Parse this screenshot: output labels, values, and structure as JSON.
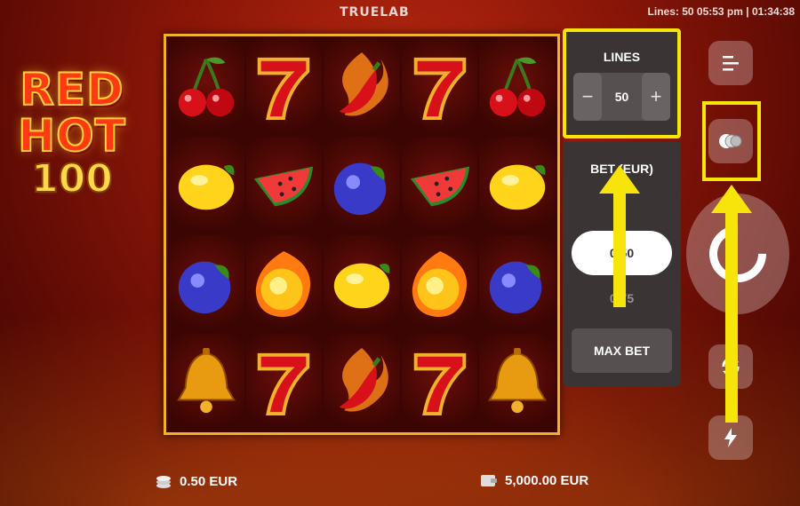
{
  "header": {
    "brand": "TRUELAB",
    "status": "Lines: 50  05:53 pm | 01:34:38"
  },
  "logo": {
    "line1": "RED",
    "line2": "HOT",
    "line3": "100"
  },
  "reels": {
    "rows": [
      [
        "cherry",
        "seven",
        "chili",
        "seven",
        "cherry"
      ],
      [
        "lemon",
        "watermelon",
        "plum",
        "watermelon",
        "lemon"
      ],
      [
        "plum",
        "fireball",
        "lemon",
        "fireball",
        "plum"
      ],
      [
        "bell",
        "seven",
        "chili",
        "seven",
        "bell"
      ]
    ]
  },
  "lines_panel": {
    "title": "LINES",
    "minus": "−",
    "value": "50",
    "plus": "+"
  },
  "bet_panel": {
    "title": "BET (EUR)",
    "selected": "0.50",
    "alternate": "0.75",
    "max_bet": "MAX BET"
  },
  "controls": {
    "menu_icon": "menu-icon",
    "coins_icon": "coins-icon",
    "spin_icon": "spin-icon",
    "autoplay_icon": "autoplay-icon",
    "turbo_icon": "turbo-icon"
  },
  "footer": {
    "bet_amount": "0.50 EUR",
    "balance": "5,000.00 EUR"
  },
  "colors": {
    "highlight": "#f6e40a",
    "panel": "#3a3435",
    "reel_border": "#f2b12a"
  }
}
